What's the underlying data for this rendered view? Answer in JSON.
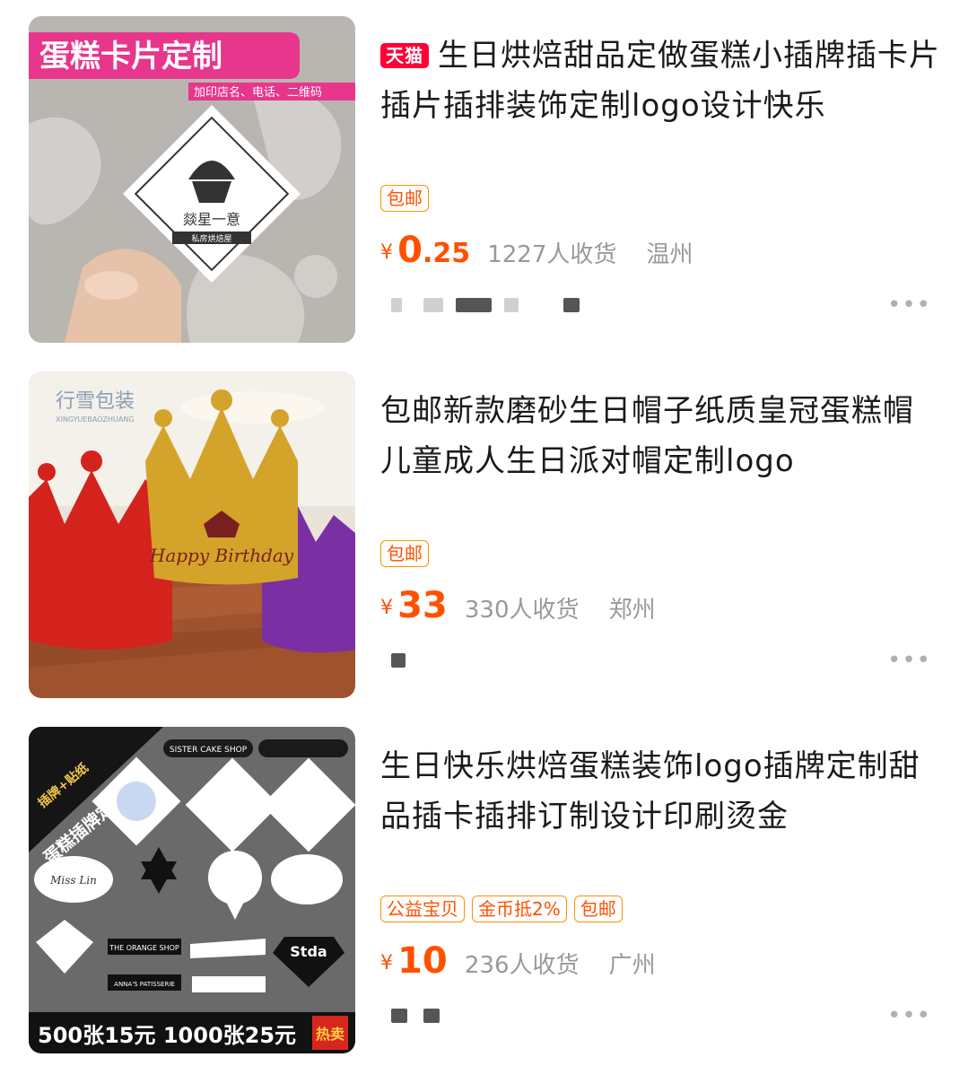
{
  "products": [
    {
      "tmall_badge": "天猫",
      "title": "生日烘焙甜品定做蛋糕小插牌插卡片插片插排装饰定制logo设计快乐",
      "tags": [
        "包邮"
      ],
      "currency": "¥",
      "price_int": "0",
      "price_dec": ".25",
      "sold": "1227人收货",
      "location": "温州",
      "image_text": {
        "banner": "蛋糕卡片定制",
        "sub": "加印店名、电话、二维码",
        "card_name": "燚星一意",
        "card_sub": "私房烘焙屋"
      }
    },
    {
      "tmall_badge": "",
      "title": "包邮新款磨砂生日帽子纸质皇冠蛋糕帽儿童成人生日派对帽定制logo",
      "tags": [
        "包邮"
      ],
      "currency": "¥",
      "price_int": "33",
      "price_dec": "",
      "sold": "330人收货",
      "location": "郑州",
      "image_text": {
        "watermark": "行雪包装",
        "watermark_sub": "XINGYUEBAOZHUANG",
        "crown_text": "Happy Birthday"
      }
    },
    {
      "tmall_badge": "",
      "title": "生日快乐烘焙蛋糕装饰logo插牌定制甜品插卡插排订制设计印刷烫金",
      "tags": [
        "公益宝贝",
        "金币抵2%",
        "包邮"
      ],
      "currency": "¥",
      "price_int": "10",
      "price_dec": "",
      "sold": "236人收货",
      "location": "广州",
      "image_text": {
        "corner_top": "插牌+贴纸",
        "corner_main": "蛋糕插牌定制",
        "promo": "500张15元 1000张25元",
        "hot": "热卖",
        "shop1": "SISTER CAKE SHOP",
        "shop2": "THE ORANGE SHOP",
        "shop3": "ANNA'S PATISSERIE",
        "shop4": "Stda",
        "shop5": "Miss Lin"
      }
    }
  ],
  "more_glyph": "•••"
}
